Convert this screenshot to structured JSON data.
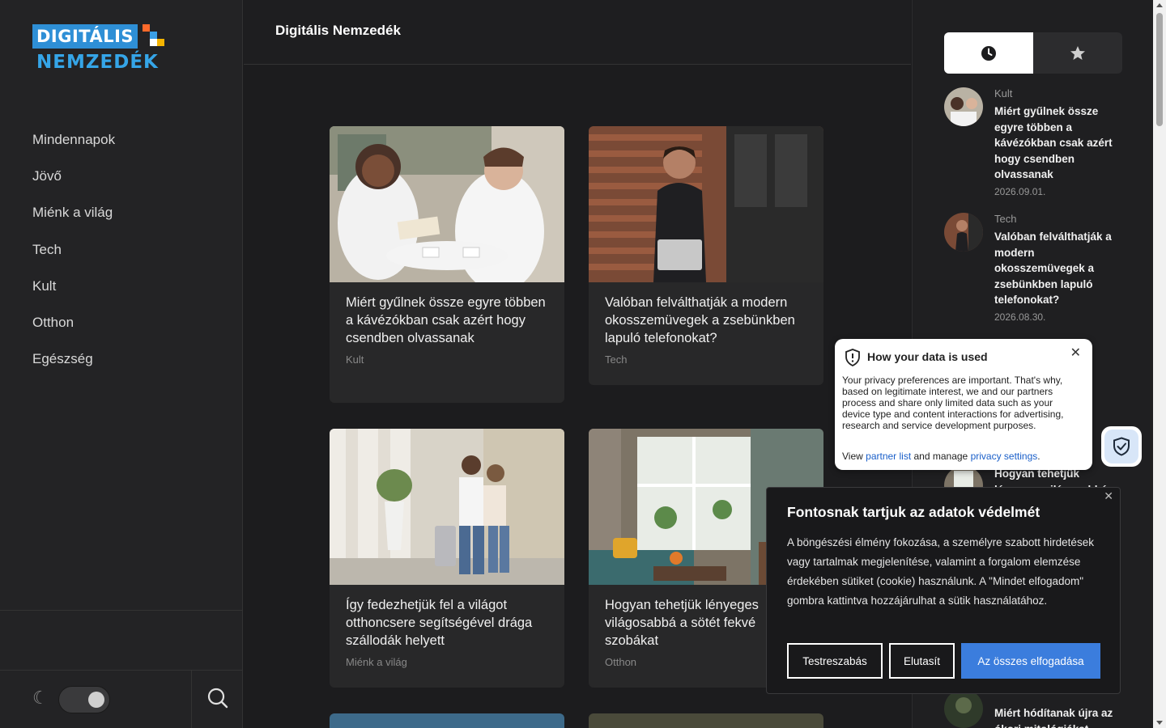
{
  "logo": {
    "line1": "DIGITÁLIS",
    "line2": "NEMZEDÉK"
  },
  "header": {
    "site_title": "Digitális Nemzedék"
  },
  "nav": {
    "items": [
      {
        "label": "Mindennapok"
      },
      {
        "label": "Jövő"
      },
      {
        "label": "Miénk a világ"
      },
      {
        "label": "Tech"
      },
      {
        "label": "Kult"
      },
      {
        "label": "Otthon"
      },
      {
        "label": "Egészség"
      }
    ]
  },
  "sidebar_bottom": {
    "moon_icon": "☾",
    "theme_toggle": "dark-mode-on",
    "search_icon": "search-icon"
  },
  "cards": [
    {
      "title": "Miért gyűlnek össze egyre többen a kávézókban csak azért hogy csendben olvassanak",
      "category": "Kult"
    },
    {
      "title": "Valóban felválthatják a modern okosszemüvegek a zsebünkben lapuló telefonokat?",
      "category": "Tech"
    },
    {
      "title": "Így fedezhetjük fel a világot otthoncsere segítségével drága szállodák helyett",
      "category": "Miénk a világ"
    },
    {
      "title": "Hogyan tehetjük lényeges világosabbá a sötét fekvé szobákat",
      "category": "Otthon"
    }
  ],
  "right_tabs": {
    "recent_icon": "clock-icon",
    "popular_icon": "star-icon"
  },
  "recent": [
    {
      "category": "Kult",
      "title": "Miért gyűlnek össze egyre többen a kávézókban csak azért hogy csendben olvassanak",
      "date": "2026.09.01."
    },
    {
      "category": "Tech",
      "title": "Valóban felválthatják a modern okosszemüvegek a zsebünkben lapuló telefonokat?",
      "date": "2026.08.30."
    },
    {
      "category": "",
      "title": "Hogyan tehetjük lényeges világosabbá",
      "date": ""
    },
    {
      "category": "",
      "title": "Miért hódítanak újra az ókori mitológiákat",
      "date": ""
    }
  ],
  "privacy_popup": {
    "title": "How your data is used",
    "close": "✕",
    "text": "Your privacy preferences are important. That's why, based on legitimate interest, we and our partners process and share only limited data such as your device type and content interactions for advertising, research and service development purposes.",
    "foot_prefix": "View ",
    "partner_link": "partner list",
    "foot_middle": " and manage ",
    "settings_link": "privacy settings",
    "foot_suffix": "."
  },
  "cookie_banner": {
    "title": "Fontosnak tartjuk az adatok védelmét",
    "close": "✕",
    "text": "A böngészési élmény fokozása, a személyre szabott hirdetések vagy tartalmak megjelenítése, valamint a forgalom elemzése érdekében sütiket (cookie) használunk. A \"Mindet elfogadom\" gombra kattintva hozzájárulhat a sütik használatához.",
    "btn_customize": "Testreszabás",
    "btn_reject": "Elutasít",
    "btn_accept": "Az összes elfogadása"
  },
  "colors": {
    "accent": "#3b7ddd",
    "logo_blue": "#2e8fd6",
    "background": "#1c1c1e"
  }
}
